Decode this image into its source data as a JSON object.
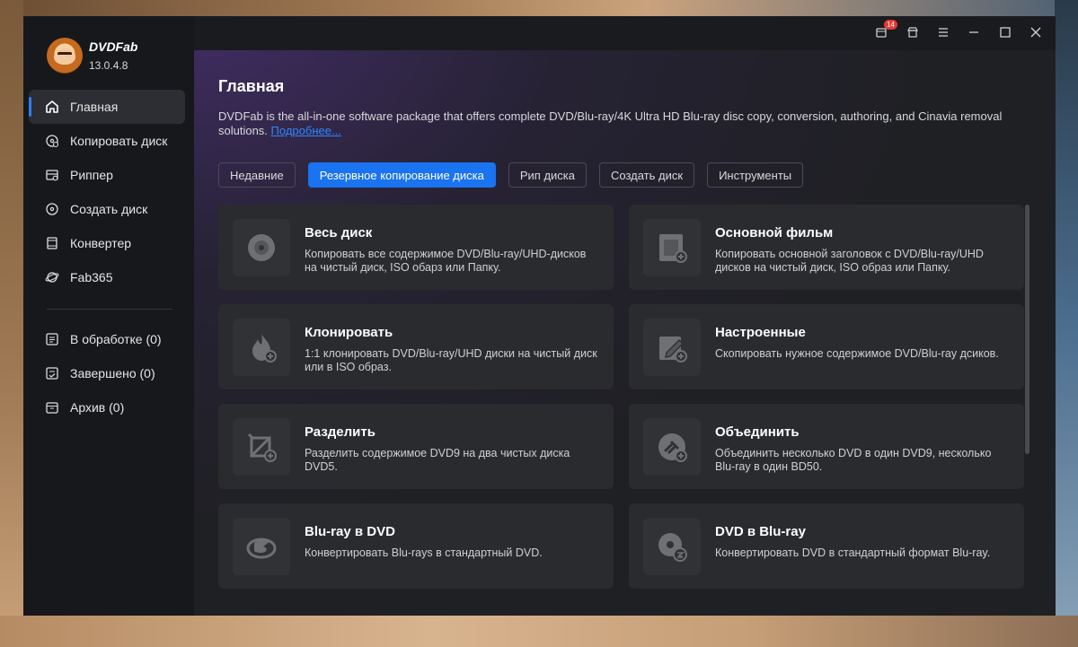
{
  "app": {
    "name": "DVDFab",
    "version": "13.0.4.8"
  },
  "sidebar": {
    "items": [
      {
        "label": "Главная",
        "icon": "home-icon"
      },
      {
        "label": "Копировать диск",
        "icon": "disc-copy-icon"
      },
      {
        "label": "Риппер",
        "icon": "ripper-icon"
      },
      {
        "label": "Создать диск",
        "icon": "disc-create-icon"
      },
      {
        "label": "Конвертер",
        "icon": "film-icon"
      },
      {
        "label": "Fab365",
        "icon": "planet-icon"
      }
    ],
    "queue": [
      {
        "label": "В обработке (0)",
        "icon": "list-icon"
      },
      {
        "label": "Завершено (0)",
        "icon": "check-list-icon"
      },
      {
        "label": "Архив (0)",
        "icon": "archive-icon"
      }
    ]
  },
  "titlebar": {
    "notification_count": "14"
  },
  "main": {
    "title": "Главная",
    "description": "DVDFab is the all-in-one software package that offers complete DVD/Blu-ray/4K Ultra HD Blu-ray disc copy, conversion, authoring, and Cinavia removal solutions.",
    "more_link": "Подробнее...",
    "tabs": [
      {
        "label": "Недавние"
      },
      {
        "label": "Резервное копирование диска"
      },
      {
        "label": "Рип диска"
      },
      {
        "label": "Создать диск"
      },
      {
        "label": "Инструменты"
      }
    ],
    "cards": [
      {
        "title": "Весь диск",
        "desc": "Копировать все содержимое DVD/Blu-ray/UHD-дисков на чистый диск, ISO обарз или Папку."
      },
      {
        "title": "Основной фильм",
        "desc": "Копировать основной заголовок с DVD/Blu-ray/UHD дисков на чистый диск, ISO образ или Папку."
      },
      {
        "title": "Клонировать",
        "desc": "1:1 клонировать DVD/Blu-ray/UHD диски на чистый диск или в ISO образ."
      },
      {
        "title": "Настроенные",
        "desc": "Скопировать нужное содержимое DVD/Blu-ray дсиков."
      },
      {
        "title": "Разделить",
        "desc": "Разделить содержимое DVD9 на два чистых диска DVD5."
      },
      {
        "title": "Объединить",
        "desc": "Объединить несколько DVD в один DVD9, несколько Blu-ray в один BD50."
      },
      {
        "title": "Blu-ray в DVD",
        "desc": "Конвертировать Blu-rays в стандартный DVD."
      },
      {
        "title": "DVD в Blu-ray",
        "desc": "Конвертировать DVD в стандартный формат Blu-ray."
      }
    ]
  },
  "colors": {
    "accent": "#1a73f0",
    "link": "#2f86ff",
    "badge": "#e53935"
  }
}
